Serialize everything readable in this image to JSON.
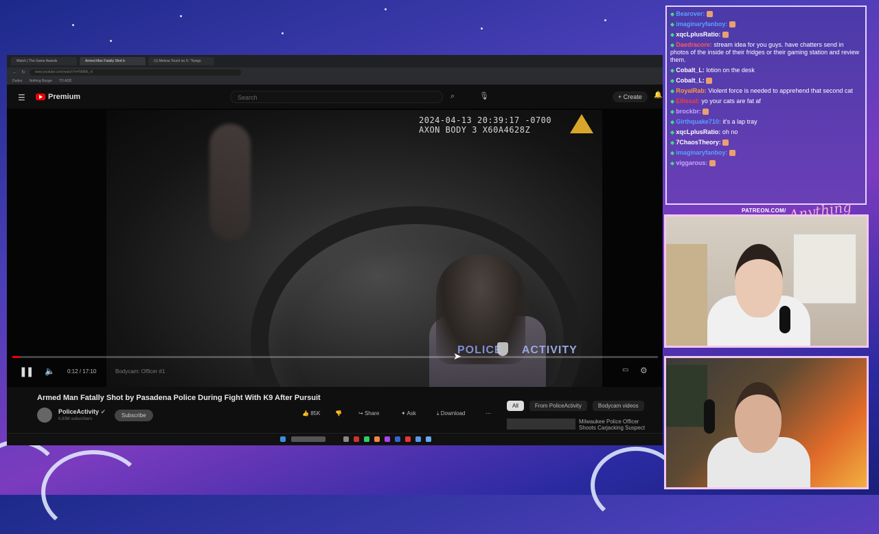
{
  "browser": {
    "tabs": [
      "Watch | The Game Awards",
      "Armed Man Fatally Shot b",
      "(1) Melosa Touch on X: \"Songs"
    ],
    "address": "www.youtube.com/watch?v=NMMk_nl",
    "bookmarks": [
      "Dudes",
      "Nothing Burger",
      "TO ADD"
    ]
  },
  "youtube": {
    "logo_text": "Premium",
    "search_placeholder": "Search",
    "create_label": "Create",
    "video": {
      "timestamp_line1": "2024-04-13 20:39:17 -0700",
      "timestamp_line2": "AXON BODY 3 X60A4628Z",
      "watermark_left": "POLICE",
      "watermark_right": "ACTIVITY",
      "time": "0:12 / 17:10",
      "chapter": "Bodycam: Officer #1",
      "progress": 0.012
    },
    "title": "Armed Man Fatally Shot by Pasadena Police During Fight With K9 After Pursuit",
    "channel": "PoliceActivity",
    "subscribers": "6.83M subscribers",
    "subscribe_label": "Subscribe",
    "likes": "85K",
    "share_label": "Share",
    "ask_label": "Ask",
    "download_label": "Download",
    "chips": [
      "All",
      "From PoliceActivity",
      "Bodycam videos"
    ],
    "recommended_title": "Milwaukee Police Officer Shoots Carjacking Suspect"
  },
  "chat": [
    {
      "name": "Bearover",
      "color": "#5aa0ff",
      "text": ""
    },
    {
      "name": "imaginaryfanboy",
      "color": "#5aa0ff",
      "text": ""
    },
    {
      "name": "xqcLplusRatio",
      "color": "#ffffff",
      "text": ""
    },
    {
      "name": "Daedracore",
      "color": "#ff5a5a",
      "text": "stream idea for you guys. have chatters send in photos of the inside of their fridges or their gaming station and review them."
    },
    {
      "name": "Cobalt_L",
      "color": "#ffffff",
      "text": "lotion on the desk"
    },
    {
      "name": "Cobalt_L",
      "color": "#ffffff",
      "text": ""
    },
    {
      "name": "RoyalRab",
      "color": "#ff9a3c",
      "text": "Violent force is needed to apprehend that second cat"
    },
    {
      "name": "Ellissat",
      "color": "#ff3a3a",
      "text": "yo your cats are fat af"
    },
    {
      "name": "brockbr",
      "color": "#c7a6ff",
      "text": ""
    },
    {
      "name": "Girthquake710",
      "color": "#5aa0ff",
      "text": "it's a lap tray"
    },
    {
      "name": "xqcLplusRatio",
      "color": "#ffffff",
      "text": "oh no"
    },
    {
      "name": "7ChaosTheory",
      "color": "#ffffff",
      "text": ""
    },
    {
      "name": "imaginaryfanboy",
      "color": "#5aa0ff",
      "text": ""
    },
    {
      "name": "viggarous",
      "color": "#c7a6ff",
      "text": ""
    }
  ],
  "overlay": {
    "patreon": "PATREON.COM/",
    "signature": "Anything Else?"
  }
}
